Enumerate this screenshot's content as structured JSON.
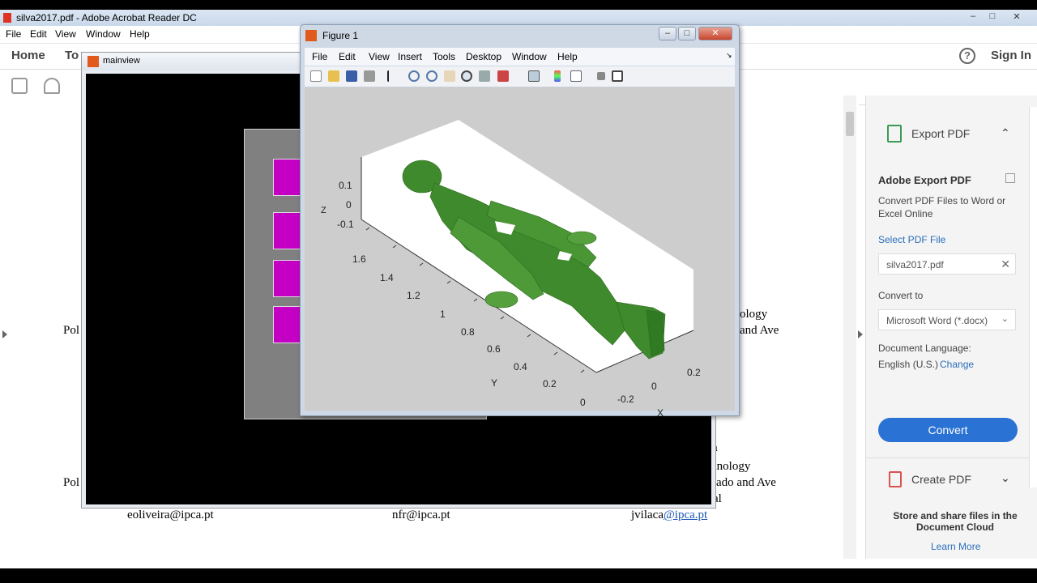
{
  "acrobat": {
    "title": "silva2017.pdf - Adobe Acrobat Reader DC",
    "menu": [
      "File",
      "Edit",
      "View",
      "Window",
      "Help"
    ],
    "nav": {
      "home": "Home",
      "tools": "To",
      "help_icon": "?",
      "sign_in": "Sign In"
    },
    "document": {
      "lines": {
        "pol_1": "Pol",
        "pol_2": "Pol",
        "ology": "ology",
        "and_ave_1": "and Ave",
        "a": "a",
        "anology": "anology",
        "ado_and_ave": "ado and Ave",
        "al": "al",
        "email_1": "eoliveira@ipca.pt",
        "email_2": "nfr@ipca.pt",
        "email_3_prefix": "jvilaca",
        "email_3_link": "@ipca.pt"
      }
    },
    "right_panel": {
      "export_pdf": "Export PDF",
      "heading": "Adobe Export PDF",
      "description": "Convert PDF Files to Word or Excel Online",
      "select_pdf_file": "Select PDF File",
      "file_name": "silva2017.pdf",
      "convert_to": "Convert to",
      "format": "Microsoft Word (*.docx)",
      "document_language": "Document Language:",
      "language": "English (U.S.)",
      "change": "Change",
      "convert_button": "Convert",
      "create_pdf": "Create PDF",
      "store_text": "Store and share files in the Document Cloud",
      "learn_more": "Learn More"
    }
  },
  "mainview": {
    "title": "mainview"
  },
  "figure": {
    "title": "Figure 1",
    "menu": [
      "File",
      "Edit",
      "View",
      "Insert",
      "Tools",
      "Desktop",
      "Window",
      "Help"
    ],
    "toolbar_icons": [
      "new-figure-icon",
      "open-file-icon",
      "save-icon",
      "print-icon",
      "pointer-icon",
      "zoom-in-icon",
      "zoom-out-icon",
      "pan-icon",
      "rotate-3d-icon",
      "data-cursor-icon",
      "brush-icon",
      "link-icon",
      "colorbar-icon",
      "legend-icon",
      "hide-plot-tools-icon",
      "show-plot-tools-icon"
    ],
    "axes": {
      "z_label": "Z",
      "y_label": "Y",
      "x_label": "X",
      "z_ticks": [
        "0.1",
        "0",
        "-0.1"
      ],
      "y_ticks": [
        "1.6",
        "1.4",
        "1.2",
        "1",
        "0.8",
        "0.6",
        "0.4",
        "0.2",
        "0"
      ],
      "x_ticks": [
        "0.2",
        "0",
        "-0.2"
      ]
    }
  }
}
